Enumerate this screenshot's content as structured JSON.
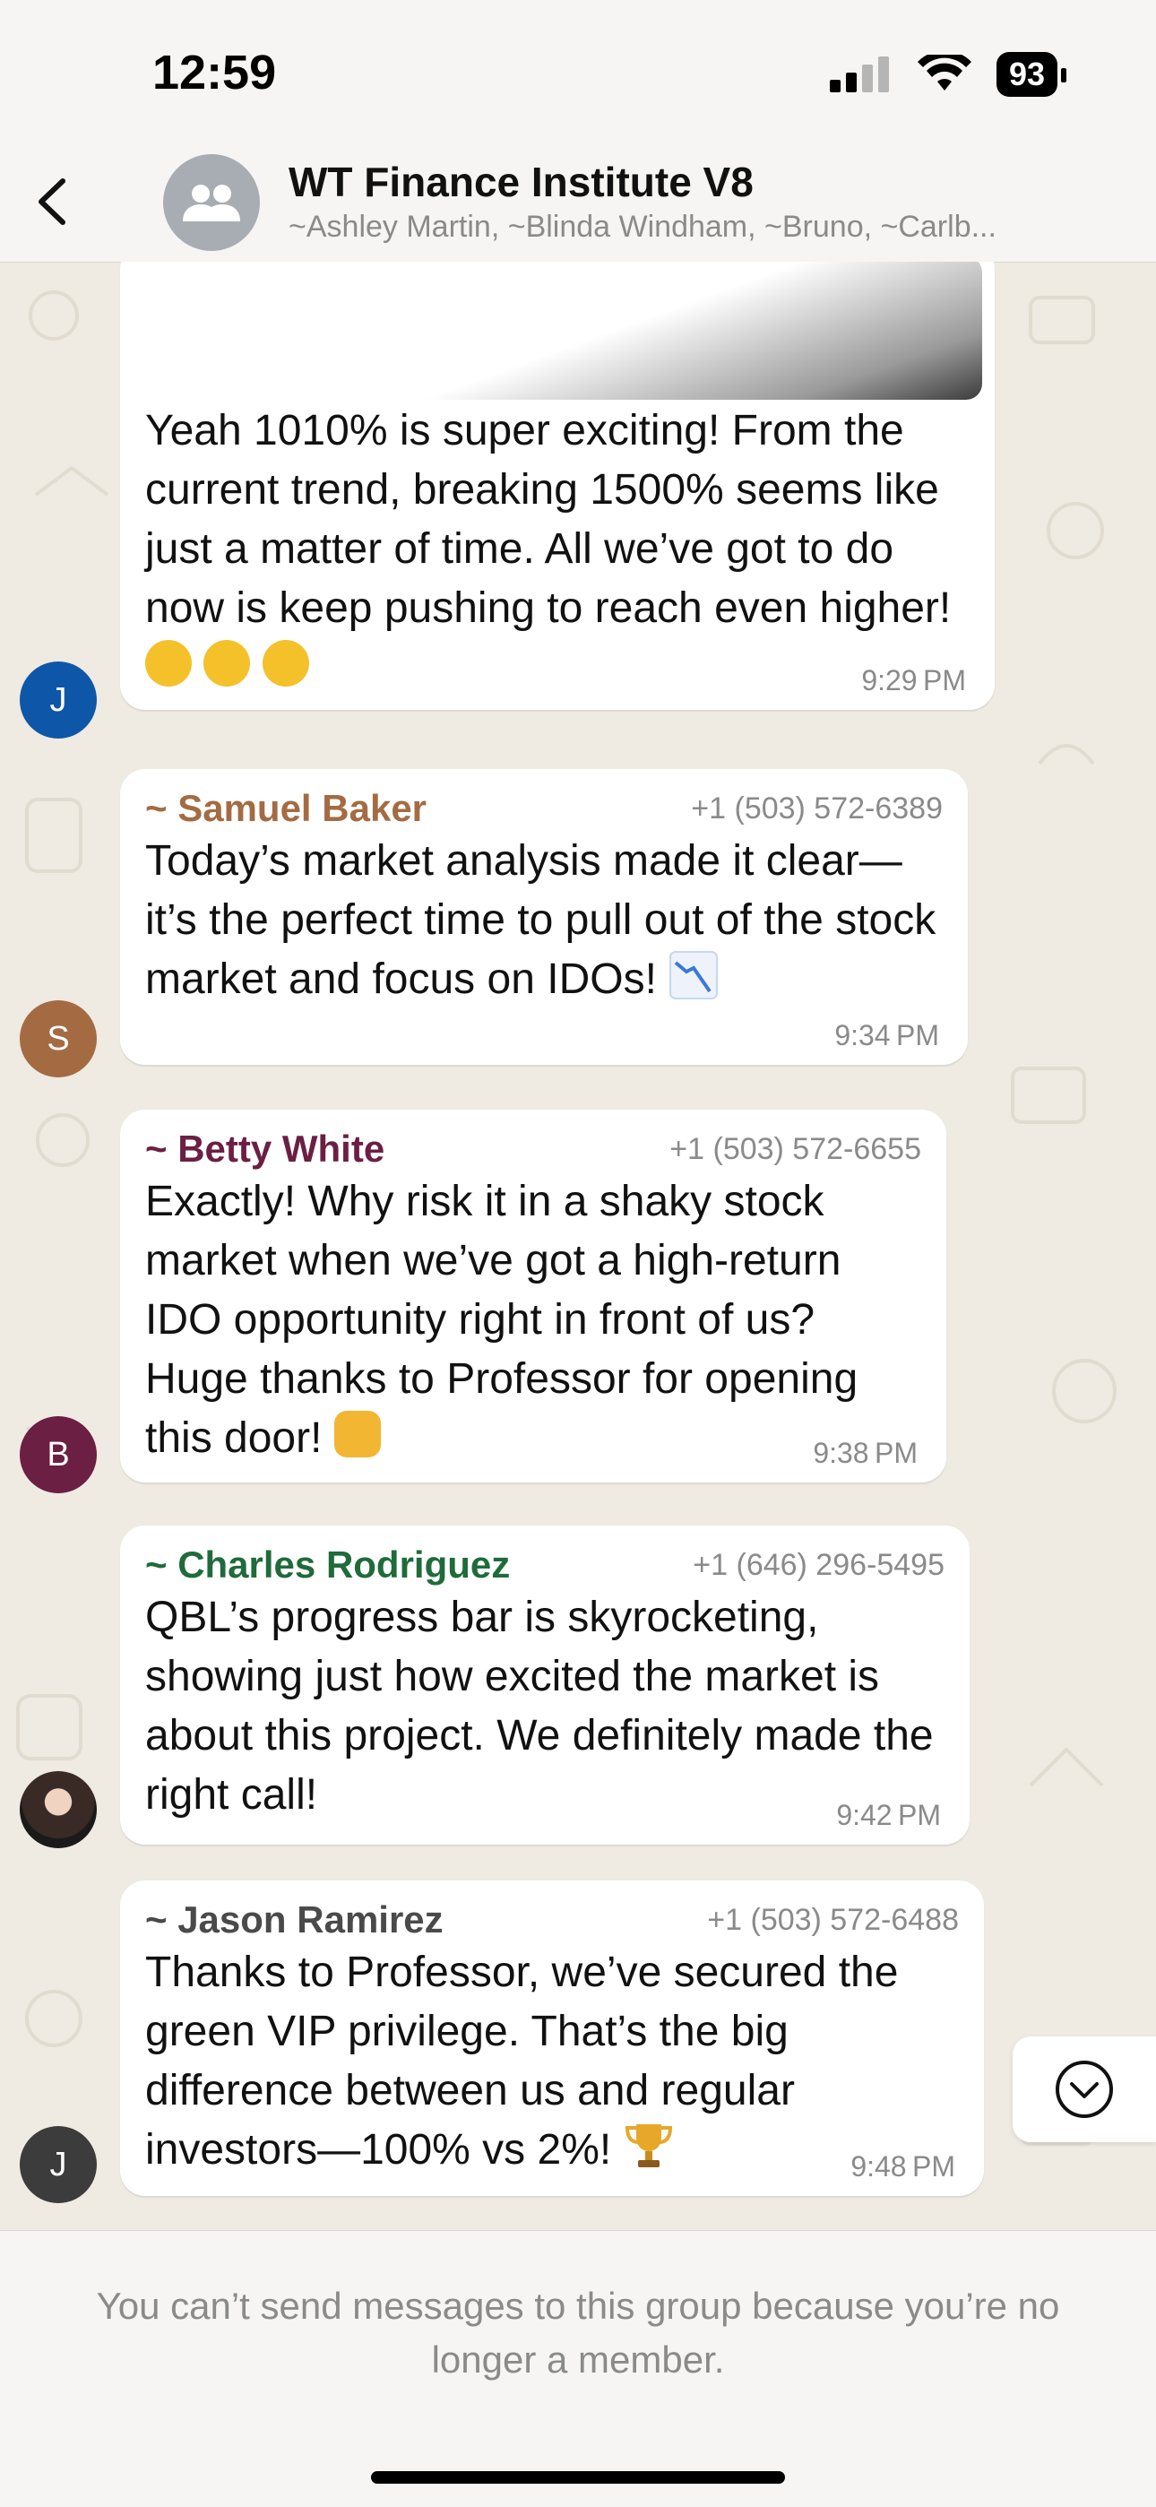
{
  "status": {
    "time": "12:59",
    "battery": "93"
  },
  "header": {
    "title": "WT Finance Institute  V8",
    "members": "~Ashley Martin, ~Blinda Windham, ~Bruno, ~Carlb..."
  },
  "messages": [
    {
      "text": "Yeah 1010% is super exciting! From the current trend, breaking 1500% seems like just a matter of time. All we’ve got to do now is keep pushing to reach even higher!",
      "emoji": "sunglasses-emoji x3",
      "time": "9:29 PM",
      "avatar_initial": "J",
      "avatar_color": "#0e57a8"
    },
    {
      "sender": "~ Samuel Baker",
      "phone": "+1 (503) 572-6389",
      "text": "Today’s market analysis made it clear—it’s the perfect time to pull out of the stock market and focus on IDOs!",
      "emoji": "chart-decreasing-emoji",
      "time": "9:34 PM",
      "avatar_initial": "S",
      "sender_color": "#a46b43"
    },
    {
      "sender": "~ Betty White",
      "phone": "+1 (503) 572-6655",
      "text": "Exactly! Why risk it in a shaky stock market when we’ve got a high-return IDO opportunity right in front of us? Huge thanks to Professor for opening this door!",
      "emoji": "raising-hands-emoji",
      "time": "9:38 PM",
      "avatar_initial": "B",
      "sender_color": "#6b1f43"
    },
    {
      "sender": "~ Charles Rodriguez",
      "phone": "+1 (646) 296-5495",
      "text": "QBL’s progress bar is skyrocketing, showing just how excited the market is about this project. We definitely made the right call!",
      "time": "9:42 PM",
      "sender_color": "#1f6b3a"
    },
    {
      "sender": "~ Jason Ramirez",
      "phone": "+1 (503) 572-6488",
      "text": "Thanks to Professor, we’ve secured the green VIP privilege. That’s the big difference between us and regular investors—100% vs 2%!",
      "emoji": "trophy-emoji",
      "time": "9:48 PM",
      "avatar_initial": "J",
      "sender_color": "#4a4a4a"
    }
  ],
  "footer": {
    "note": "You can’t send messages to this group because you’re no longer a member."
  }
}
